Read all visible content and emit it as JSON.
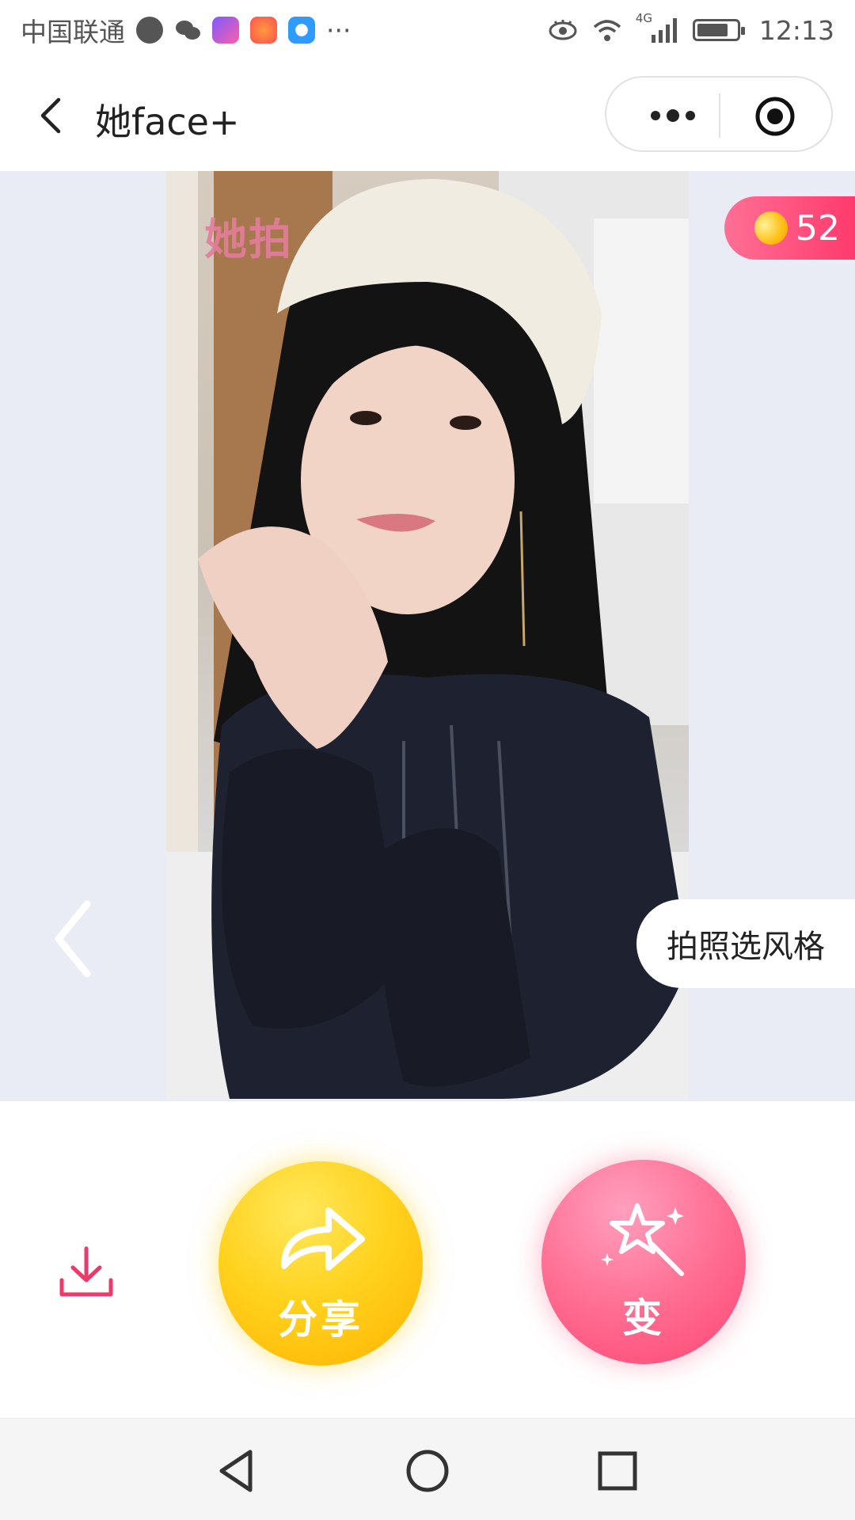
{
  "status_bar": {
    "carrier": "中国联通",
    "overflow": "···",
    "network": "4G",
    "time": "12:13",
    "icons": [
      "qq-icon",
      "wechat-icon",
      "video-app-icon",
      "pinwheel-app-icon",
      "browser-app-icon",
      "eye-comfort-icon",
      "wifi-icon",
      "signal-icon",
      "battery-icon"
    ]
  },
  "title_bar": {
    "title": "她face+",
    "icons": [
      "back-icon",
      "more-icon",
      "close-target-icon"
    ]
  },
  "photo": {
    "watermark": "她拍"
  },
  "coin_badge": {
    "count": "52"
  },
  "style_pill": {
    "label": "拍照选风格"
  },
  "actions": {
    "share_label": "分享",
    "magic_label": "变",
    "icons": [
      "download-icon",
      "share-arrow-icon",
      "magic-wand-icon",
      "chevron-left-icon"
    ]
  },
  "colors": {
    "accent_pink": "#ff3a6d",
    "share_yellow": "#ffd21e",
    "stage_bg": "#e9ecf5"
  },
  "nav_bar": {
    "icons": [
      "nav-back-icon",
      "nav-home-icon",
      "nav-recents-icon"
    ]
  }
}
